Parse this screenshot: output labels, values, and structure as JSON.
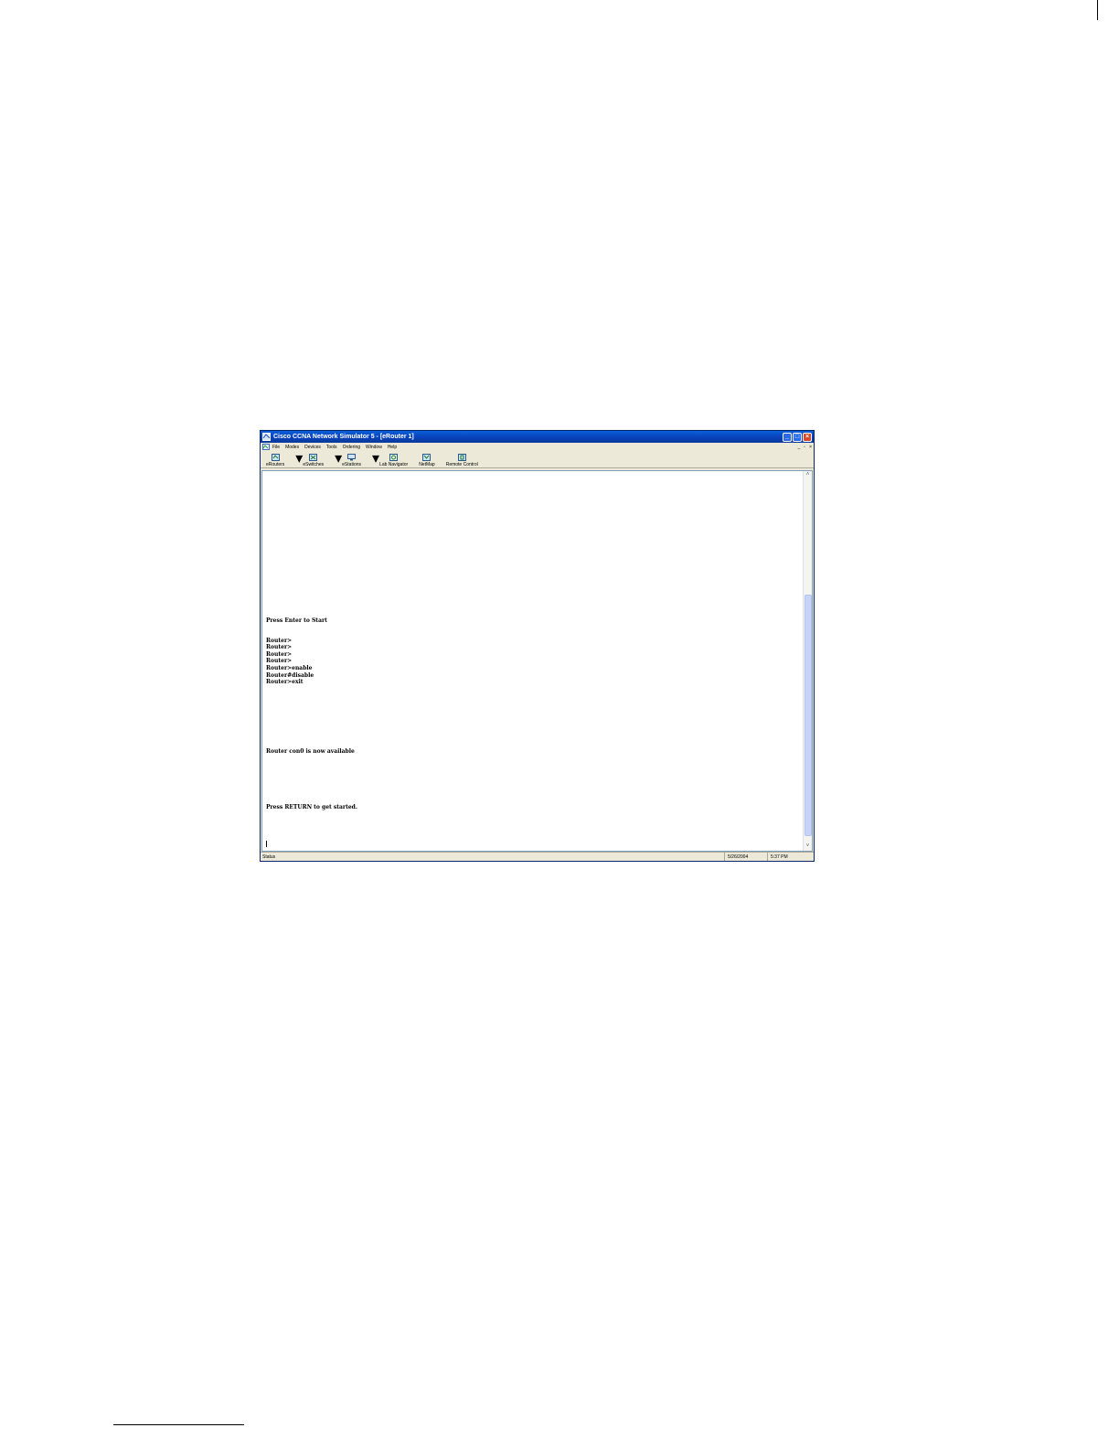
{
  "window": {
    "title": "Cisco CCNA Network Simulator 5 - [eRouter 1]",
    "controls": {
      "minimize": "_",
      "maximize": "□",
      "close": "×"
    },
    "mdi_controls": {
      "minimize": "_",
      "restore": "▫",
      "close": "×"
    }
  },
  "menu": {
    "items": [
      "File",
      "Modes",
      "Devices",
      "Tools",
      "Ordering",
      "Window",
      "Help"
    ]
  },
  "toolbar": {
    "buttons": [
      {
        "label": "eRouters",
        "icon": "router-icon",
        "dropdown": true
      },
      {
        "label": "eSwitches",
        "icon": "switch-icon",
        "dropdown": true
      },
      {
        "label": "eStations",
        "icon": "station-icon",
        "dropdown": true
      },
      {
        "label": "Lab Navigator",
        "icon": "navigator-icon",
        "dropdown": false
      },
      {
        "label": "NetMap",
        "icon": "netmap-icon",
        "dropdown": false
      },
      {
        "label": "Remote Control",
        "icon": "remote-icon",
        "dropdown": false
      }
    ],
    "dropdown_glyph": "▾"
  },
  "terminal": {
    "lines": [
      "Press Enter to Start",
      "Router>",
      "Router>",
      "Router>",
      "Router>",
      "Router>enable",
      "Router#disable",
      "Router>exit",
      "Router con0 is now available",
      "Press RETURN to get started."
    ]
  },
  "scrollbar": {
    "up": "˄",
    "down": "˅"
  },
  "statusbar": {
    "status": "Status",
    "date": "5/26/2004",
    "time": "5:37 PM"
  },
  "colors": {
    "titlebar": "#0a4fc8",
    "close_button": "#d8482a",
    "chrome": "#ece9d8",
    "scroll_thumb": "#c6d3f7"
  }
}
